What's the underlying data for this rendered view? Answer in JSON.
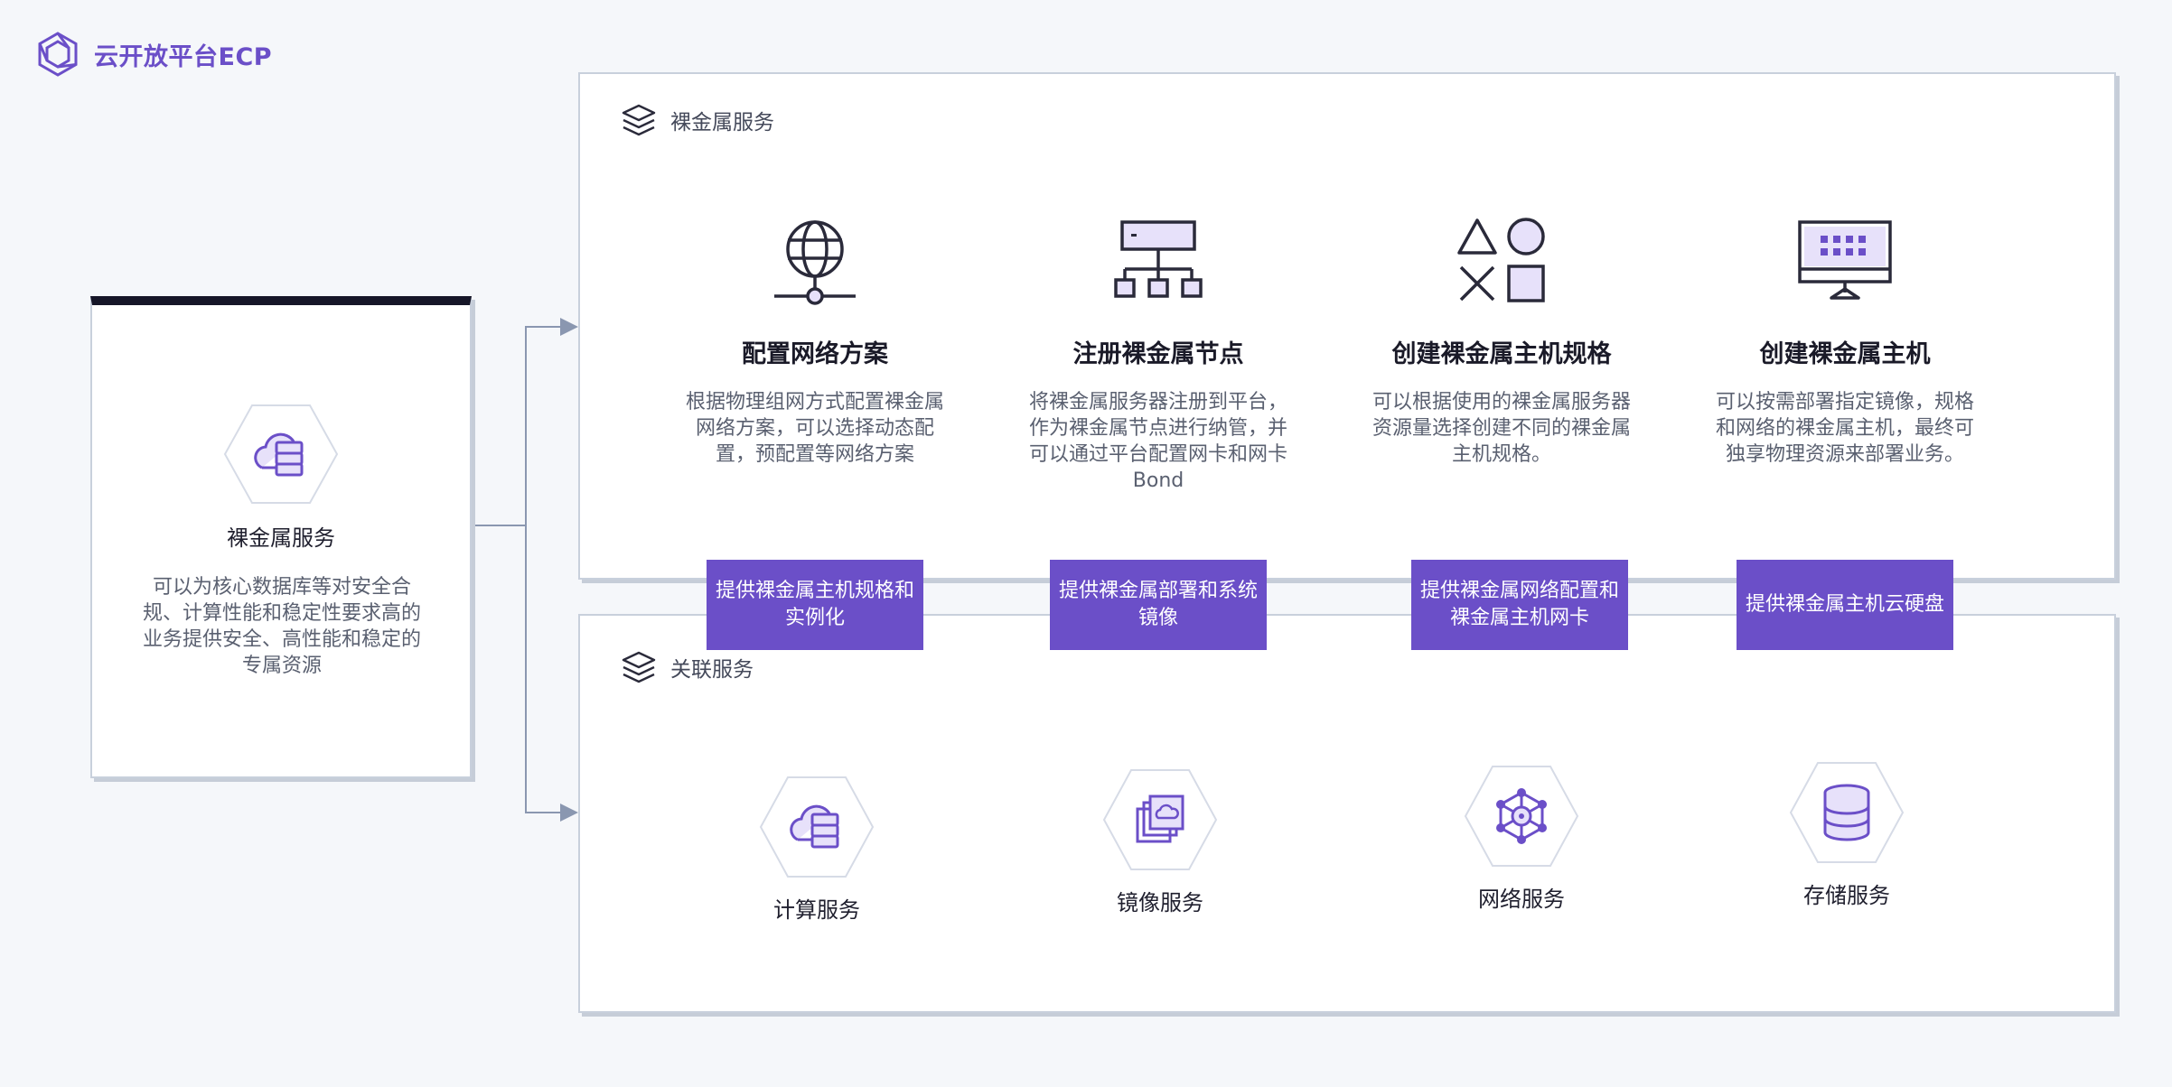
{
  "logo": {
    "text": "云开放平台ECP",
    "icon": "hexagon-logo-icon",
    "color": "#6b4fc8"
  },
  "left_card": {
    "title": "裸金属服务",
    "description": "可以为核心数据库等对安全合规、计算性能和稳定性要求高的业务提供安全、高性能和稳定的专属资源",
    "icon": "cloud-server-icon"
  },
  "top_panel": {
    "title": "裸金属服务",
    "features": [
      {
        "title": "配置网络方案",
        "description": "根据物理组网方式配置裸金属网络方案，可以选择动态配置，预配置等网络方案",
        "icon": "globe-network-icon"
      },
      {
        "title": "注册裸金属节点",
        "description": "将裸金属服务器注册到平台，作为裸金属节点进行纳管，并可以通过平台配置网卡和网卡Bond",
        "icon": "hierarchy-icon"
      },
      {
        "title": "创建裸金属主机规格",
        "description": "可以根据使用的裸金属服务器资源量选择创建不同的裸金属主机规格。",
        "icon": "shapes-icon"
      },
      {
        "title": "创建裸金属主机",
        "description": "可以按需部署指定镜像，规格和网络的裸金属主机，最终可独享物理资源来部署业务。",
        "icon": "monitor-icon"
      }
    ]
  },
  "connectors": [
    {
      "label": "提供裸金属主机规格和实例化"
    },
    {
      "label": "提供裸金属部署和系统镜像"
    },
    {
      "label": "提供裸金属网络配置和裸金属主机网卡"
    },
    {
      "label": "提供裸金属主机云硬盘"
    }
  ],
  "bottom_panel": {
    "title": "关联服务",
    "services": [
      {
        "label": "计算服务",
        "icon": "cloud-server-icon"
      },
      {
        "label": "镜像服务",
        "icon": "image-stack-icon"
      },
      {
        "label": "网络服务",
        "icon": "network-gear-icon"
      },
      {
        "label": "存储服务",
        "icon": "database-icon"
      }
    ]
  },
  "colors": {
    "accent": "#6b4fc8",
    "icon_fill": "#e7e1fa",
    "dark": "#161628",
    "border": "#c8d0dc",
    "line": "#8a97b0"
  }
}
